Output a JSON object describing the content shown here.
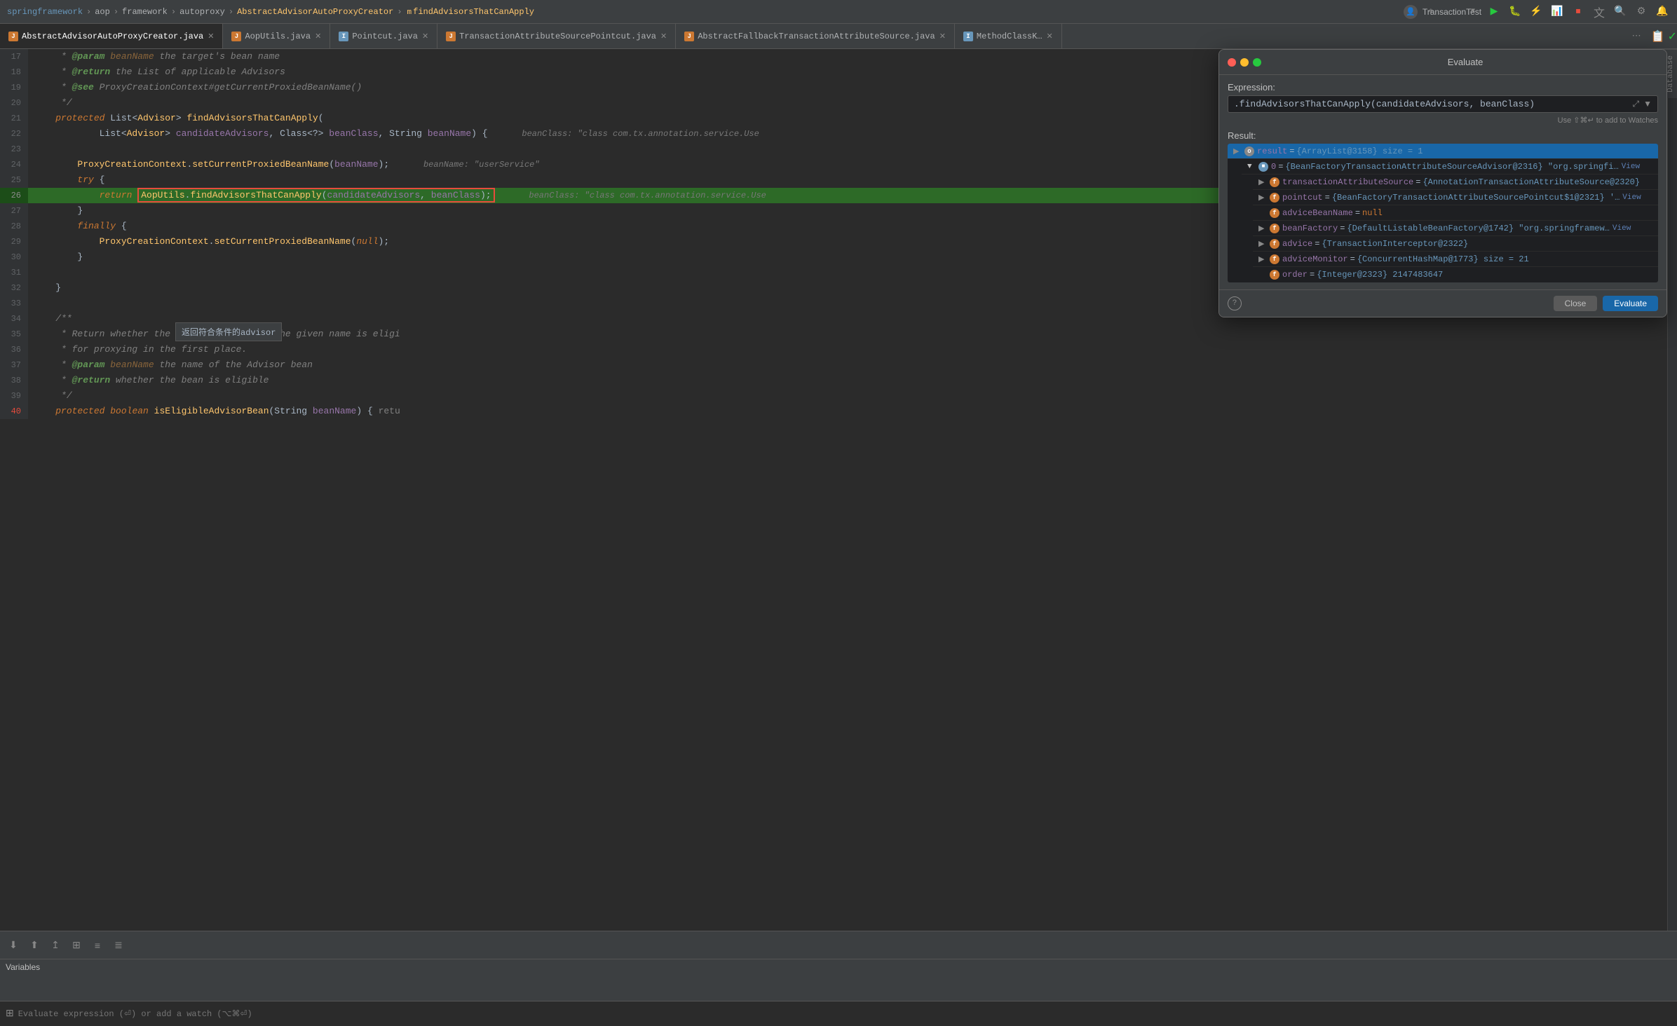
{
  "breadcrumb": {
    "items": [
      "springframework",
      "aop",
      "framework",
      "autoproxy",
      "AbstractAdvisorAutoProxyCreator",
      "findAdvisorsThatCanApply"
    ],
    "separators": [
      ">",
      ">",
      ">",
      ">",
      ">"
    ]
  },
  "run_config": {
    "name": "TransactionTest"
  },
  "tabs": [
    {
      "label": "AbstractAdvisorAutoProxyCreator.java",
      "type": "java",
      "active": true
    },
    {
      "label": "AopUtils.java",
      "type": "java",
      "active": false
    },
    {
      "label": "Pointcut.java",
      "type": "interface",
      "active": false
    },
    {
      "label": "TransactionAttributeSourcePointcut.java",
      "type": "java",
      "active": false
    },
    {
      "label": "AbstractFallbackTransactionAttributeSource.java",
      "type": "java",
      "active": false
    },
    {
      "label": "MethodClassK…",
      "type": "java",
      "active": false
    }
  ],
  "code_lines": [
    {
      "num": 17,
      "content": "     * @param beanName the target's bean name",
      "highlight": false
    },
    {
      "num": 18,
      "content": "     * @return the List of applicable Advisors",
      "highlight": false
    },
    {
      "num": 19,
      "content": "     * @see ProxyCreationContext#getCurrentProxiedBeanName()",
      "highlight": false
    },
    {
      "num": 20,
      "content": "     */",
      "highlight": false
    },
    {
      "num": 21,
      "content": "    protected List<Advisor> findAdvisorsThatCanApply(",
      "highlight": false
    },
    {
      "num": 22,
      "content": "            List<Advisor> candidateAdvisors, Class<?> beanClass, String beanName) {    beanClass: \"class com.tx.annotation.service.Use",
      "highlight": false
    },
    {
      "num": 23,
      "content": "",
      "highlight": false
    },
    {
      "num": 24,
      "content": "        ProxyCreationContext.setCurrentProxiedBeanName(beanName);    beanName: \"userService\"",
      "highlight": false
    },
    {
      "num": 25,
      "content": "        try {",
      "highlight": false
    },
    {
      "num": 26,
      "content": "            return AopUtils.findAdvisorsThatCanApply(candidateAdvisors, beanClass);    beanClass: \"class com.tx.annotation.service.Use",
      "highlight": true
    },
    {
      "num": 27,
      "content": "        }",
      "highlight": false
    },
    {
      "num": 28,
      "content": "        finally {",
      "highlight": false
    },
    {
      "num": 29,
      "content": "            ProxyCreationContext.setCurrentProxiedBeanName(null);",
      "highlight": false
    },
    {
      "num": 30,
      "content": "        }",
      "highlight": false
    },
    {
      "num": 31,
      "content": "",
      "highlight": false
    },
    {
      "num": 32,
      "content": "    }",
      "highlight": false
    },
    {
      "num": 33,
      "content": "",
      "highlight": false
    },
    {
      "num": 34,
      "content": "    /**",
      "highlight": false
    },
    {
      "num": 35,
      "content": "     * Return whether the Advisor bean with the given name is eligi",
      "highlight": false
    },
    {
      "num": 36,
      "content": "     * for proxying in the first place.",
      "highlight": false
    },
    {
      "num": 37,
      "content": "     * @param beanName the name of the Advisor bean",
      "highlight": false
    },
    {
      "num": 38,
      "content": "     * @return whether the bean is eligible",
      "highlight": false
    },
    {
      "num": 39,
      "content": "     */",
      "highlight": false
    },
    {
      "num": 40,
      "content": "    protected boolean isEligibleAdvisorBean(String beanName) { retu",
      "highlight": false
    }
  ],
  "tooltip": {
    "text": "返回符合条件的advisor"
  },
  "evaluate_panel": {
    "title": "Evaluate",
    "expression_label": "Expression:",
    "expression_value": ".findAdvisorsThatCanApply(candidateAdvisors, beanClass)",
    "hint": "Use ⇧⌘↵ to add to Watches",
    "result_label": "Result:",
    "results": [
      {
        "id": "root",
        "indent": 0,
        "arrow": "▶",
        "icon": "o",
        "key": "result",
        "eq": "=",
        "value": "{ArrayList@3158}  size = 1",
        "selected": true
      },
      {
        "id": "item0",
        "indent": 1,
        "arrow": "▼",
        "icon": "c",
        "key": "0",
        "eq": "=",
        "value": "{BeanFactoryTransactionAttributeSourceAdvisor@2316} \"org.springfi…",
        "link": "View"
      },
      {
        "id": "transAttr",
        "indent": 2,
        "arrow": "▶",
        "icon": "f",
        "key": "transactionAttributeSource",
        "eq": "=",
        "value": "{AnnotationTransactionAttributeSource@2320}"
      },
      {
        "id": "pointcut",
        "indent": 2,
        "arrow": "▶",
        "icon": "f",
        "key": "pointcut",
        "eq": "=",
        "value": "{BeanFactoryTransactionAttributeSourcePointcut$1@2321} '…",
        "link": "View"
      },
      {
        "id": "adviceBeanName",
        "indent": 2,
        "arrow": "",
        "icon": "f",
        "key": "adviceBeanName",
        "eq": "=",
        "value": "null",
        "null": true
      },
      {
        "id": "beanFactory",
        "indent": 2,
        "arrow": "▶",
        "icon": "f",
        "key": "beanFactory",
        "eq": "=",
        "value": "{DefaultListableBeanFactory@1742} \"org.springframew…",
        "link": "View"
      },
      {
        "id": "advice",
        "indent": 2,
        "arrow": "▶",
        "icon": "f",
        "key": "advice",
        "eq": "=",
        "value": "{TransactionInterceptor@2322}"
      },
      {
        "id": "adviceMonitor",
        "indent": 2,
        "arrow": "▶",
        "icon": "f",
        "key": "adviceMonitor",
        "eq": "=",
        "value": "{ConcurrentHashMap@1773}  size = 21"
      },
      {
        "id": "order",
        "indent": 2,
        "arrow": "",
        "icon": "f",
        "key": "order",
        "eq": "=",
        "value": "{Integer@2323}  2147483647"
      }
    ],
    "close_button": "Close",
    "evaluate_button": "Evaluate"
  },
  "vars_panel": {
    "label": "Variables"
  },
  "expr_bar": {
    "placeholder": "Evaluate expression (⏎) or add a watch (⌥⌘⏎)"
  },
  "bottom_toolbar": {
    "buttons": [
      "↓",
      "↑",
      "↑↑",
      "⊡",
      "≡",
      "≡≡"
    ]
  }
}
